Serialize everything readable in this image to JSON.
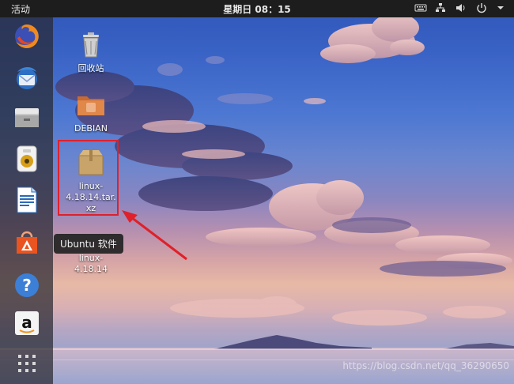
{
  "topbar": {
    "activities_label": "活动",
    "clock": "星期日 08：15",
    "tray_icons": [
      "keyboard-icon",
      "network-icon",
      "volume-icon",
      "power-icon",
      "chevron-down-icon"
    ]
  },
  "dock": {
    "items": [
      {
        "icon": "firefox-icon"
      },
      {
        "icon": "thunderbird-icon"
      },
      {
        "icon": "files-icon"
      },
      {
        "icon": "rhythmbox-icon"
      },
      {
        "icon": "libreoffice-writer-icon"
      },
      {
        "icon": "ubuntu-software-icon"
      },
      {
        "icon": "help-icon"
      },
      {
        "icon": "amazon-icon"
      },
      {
        "icon": "show-applications-icon"
      }
    ]
  },
  "desktop": {
    "icons": [
      {
        "label": "回收站",
        "icon": "trash-icon"
      },
      {
        "label": "DEBIAN",
        "icon": "folder-icon"
      },
      {
        "label": "linux-4.18.14.tar.xz",
        "label_lines": [
          "linux-",
          "4.18.14.tar.",
          "xz"
        ],
        "icon": "archive-icon",
        "selected": true
      },
      {
        "label": "linux-4.18.14",
        "label_lines": [
          "linux-",
          "4.18.14"
        ],
        "icon": "folder-icon"
      }
    ]
  },
  "tooltip": {
    "text": "Ubuntu 软件"
  },
  "watermark": {
    "text": "https://blog.csdn.net/qq_36290650"
  },
  "colors": {
    "topbar": "#1d1d1d",
    "selection": "#e0202a",
    "folder": "#e0874a",
    "archive": "#c8a46a"
  }
}
